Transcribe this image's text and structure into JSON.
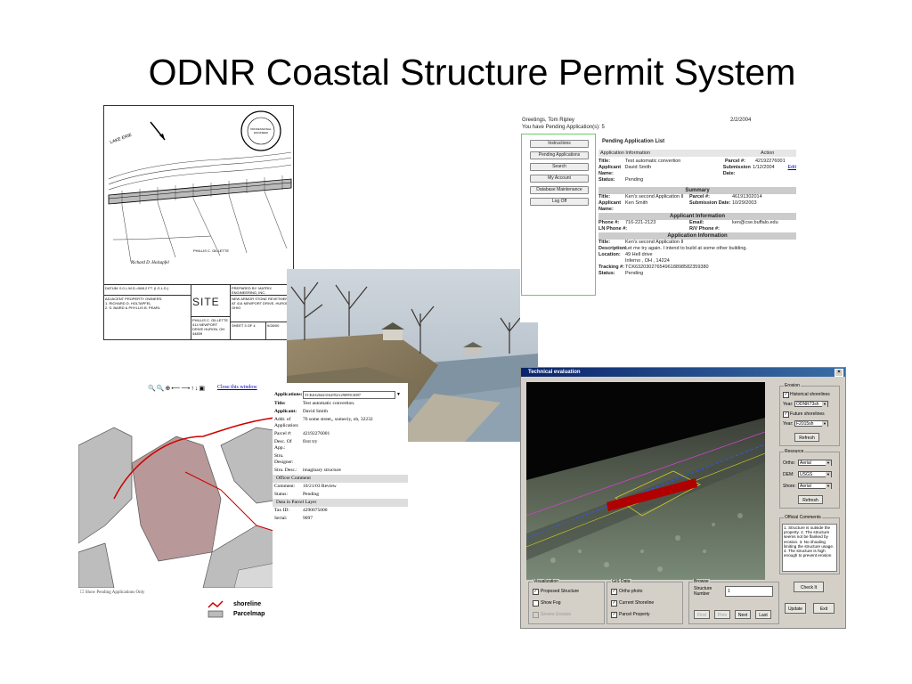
{
  "slide": {
    "title": "ODNR Coastal Structure Permit System"
  },
  "site_plan": {
    "datum": "DATUM: 0.0 L.W.D.=568.2 FT. (I.G.L.D.)",
    "owners_heading": "ADJACENT PROPERTY OWNERS:",
    "owner1": "1. RICHARD D. HOLTAPFEL",
    "owner2": "2. S. BAIRD & PHYLLIS B. PEARL",
    "stamp_label": "PROFESSIONAL ENGINEER",
    "sign1": "Richard D. Holzapfel",
    "sign2": "PHILLIS C. GILLETTE",
    "site_plan_label": "SITE PLAN",
    "owner_block": "PHILLIS C. GILLETTE 414 NEWPORT DRIVE HURON, OH 44839",
    "prepared_by": "PREPARED BY: MATRIX ENGINEERING, INC.",
    "description": "NEW ARMOR STONE REVETMENT AT 414 NEWPORT DRIVE, HURON, OHIO",
    "sheet": "SHEET 3 OF 4",
    "date": "9/28/00",
    "lake_label": "LAKE ERIE"
  },
  "web_app": {
    "greeting": "Greetings, Tom Ripley",
    "pending_count": "You have Pending Application(s): 5",
    "date": "2/2/2004",
    "nav": [
      "Instructions",
      "Pending Applications",
      "Search",
      "My Account",
      "Database Maintenance",
      "Log Off"
    ],
    "list_title": "Pending Application List",
    "col_info": "Application Information",
    "col_action": "Action",
    "row": {
      "title_label": "Title:",
      "title_value": "Test automatic convertion",
      "parcel_label": "Parcel #:",
      "parcel_value": "42192276001",
      "applicant_label": "Applicant Name:",
      "applicant_value": "David Smith",
      "submission_label": "Submission Date:",
      "submission_value": "1/12/2004",
      "status_label": "Status:",
      "status_value": "Pending",
      "edit": "Edit"
    },
    "summary": {
      "heading": "Summary",
      "title_label": "Title:",
      "title_value": "Ken's second Application II",
      "parcel_label": "Parcel #:",
      "parcel_value": "46191302014",
      "applicant_label": "Applicant Name:",
      "applicant_value": "Ken Smith",
      "submission_label": "Submission Date:",
      "submission_value": "10/29/2003",
      "applicant_info": "Applicant Information",
      "phone_label": "Phone #:",
      "phone_value": "716-221-2123",
      "email_label": "Email:",
      "email_value": "ken@cse.buffalo.edu",
      "ln_label": "LN Phone #:",
      "rv_label": "R/V Phone #:",
      "app_info": "Application Information",
      "title2_label": "Title:",
      "title2_value": "Ken's second Application II",
      "desc_label": "Description:",
      "desc_value": "Let me try again. I intend to build at some other building.",
      "loc_label": "Location:",
      "loc_value1": "49 Hell drive",
      "loc_value2": "Inferno , OH , 14224",
      "track_label": "Tracking #:",
      "track_value": "TCK632030276549618898582359380",
      "status_label": "Status:",
      "status_value": "Pending"
    }
  },
  "map_app": {
    "close_link": "Close this window",
    "applications_label": "Applications:",
    "applications_value": "TCK632042316295212909913087",
    "fields": [
      {
        "k": "Title:",
        "v": "Test automatic convertion."
      },
      {
        "k": "Applicant:",
        "v": "David Smith"
      },
      {
        "k": "Addr. of Application:",
        "v": "76 some street,, someciy, oh, 32232"
      },
      {
        "k": "Parcel #:",
        "v": "42192276001"
      },
      {
        "k": "Desc. Of App.:",
        "v": "first try"
      },
      {
        "k": "Stru. Designer:",
        "v": ""
      },
      {
        "k": "Stru. Desc.:",
        "v": "imaginary structure"
      }
    ],
    "officer_band": "Officer Comment",
    "officer_fields": [
      {
        "k": "Comment:",
        "v": "10/21/03 Review"
      },
      {
        "k": "Status:",
        "v": "Pending"
      }
    ],
    "parcel_band": "Data in Parcel Layer",
    "parcel_fields": [
      {
        "k": "Tax ID:",
        "v": "4290075000"
      },
      {
        "k": "Serial:",
        "v": "9097"
      }
    ],
    "show_pending": "Show Pending Applications Only",
    "legend_shoreline": "shoreline",
    "legend_parcelmap": "Parcelmap"
  },
  "tech_eval": {
    "title": "Technical evaluation",
    "close": "×",
    "erosion": {
      "label": "Erosion",
      "historical": "Historical shorelines",
      "year_label": "Year:",
      "year_value": "ODNR73sh",
      "future": "Future shorelines",
      "year2_value": "F2015sh",
      "refresh": "Refresh"
    },
    "resource": {
      "label": "Resource",
      "ortho_label": "Ortho:",
      "ortho_value": "Aerial",
      "dem_label": "DEM:",
      "dem_value": "USGS",
      "shore_label": "Shore:",
      "shore_value": "Aerial",
      "refresh": "Refresh"
    },
    "comments": {
      "label": "Official Comments",
      "text": "1. Structure is outside the property.  2. The structure seems not be flanked by erosion. 3. No shoaling limiting the structure usage. 4. The structure is high enough to prevent erosion"
    },
    "visualization": {
      "label": "Visualization",
      "proposed": "Proposed Structure",
      "fog": "Show Fog",
      "severe": "Severe Erosion"
    },
    "gis": {
      "label": "GIS Data",
      "ortho": "Ortho photo",
      "current": "Current Shoreline",
      "parcel": "Parcel Property"
    },
    "browse": {
      "label": "Browse",
      "structure_label": "Structure Number",
      "structure_value": "1",
      "first": "First",
      "prev": "Prev",
      "next": "Next",
      "last": "Last"
    },
    "check": "Check It",
    "update": "Update",
    "exit": "Exit"
  }
}
